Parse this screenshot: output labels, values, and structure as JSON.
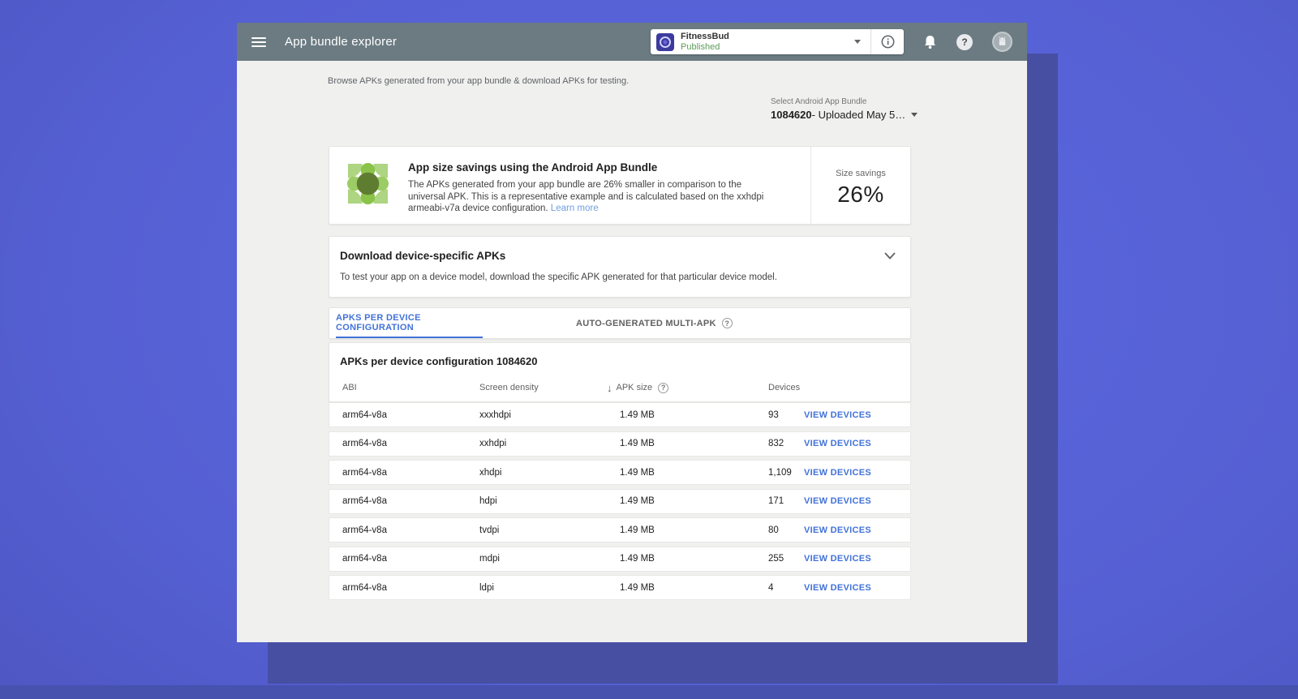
{
  "header": {
    "title": "App bundle explorer",
    "app_selector": {
      "name": "FitnessBud",
      "status": "Published"
    },
    "icons": [
      "menu",
      "app-logo",
      "dropdown-caret",
      "info",
      "notifications-bell",
      "help",
      "avatar-android"
    ]
  },
  "page": {
    "subtitle": "Browse APKs generated from your app bundle & download APKs for testing."
  },
  "bundle_select": {
    "label": "Select Android App Bundle",
    "value_bold": "1084620",
    "value_rest": " - Uploaded May 5…"
  },
  "savings_card": {
    "title": "App size savings using the Android App Bundle",
    "body": "The APKs generated from your app bundle are 26% smaller in comparison to the universal APK. This is a representative example and is calculated based on the xxhdpi armeabi-v7a device configuration. ",
    "learn_more": "Learn more",
    "savings_label": "Size savings",
    "savings_value": "26%"
  },
  "download_card": {
    "title": "Download device-specific APKs",
    "body": "To test your app on a device model, download the specific APK generated for that particular device model."
  },
  "tabs": [
    {
      "label": "APKS PER DEVICE CONFIGURATION",
      "active": true
    },
    {
      "label": "AUTO-GENERATED MULTI-APK",
      "active": false,
      "help_icon": true
    }
  ],
  "table": {
    "heading": "APKs per device configuration 1084620",
    "columns": {
      "abi": "ABI",
      "density": "Screen density",
      "size": "APK size",
      "devices": "Devices"
    },
    "sort_arrow": "↓",
    "action_label": "VIEW DEVICES",
    "rows": [
      {
        "abi": "arm64-v8a",
        "density": "xxxhdpi",
        "size": "1.49 MB",
        "devices": "93"
      },
      {
        "abi": "arm64-v8a",
        "density": "xxhdpi",
        "size": "1.49 MB",
        "devices": "832"
      },
      {
        "abi": "arm64-v8a",
        "density": "xhdpi",
        "size": "1.49 MB",
        "devices": "1,109"
      },
      {
        "abi": "arm64-v8a",
        "density": "hdpi",
        "size": "1.49 MB",
        "devices": "171"
      },
      {
        "abi": "arm64-v8a",
        "density": "tvdpi",
        "size": "1.49 MB",
        "devices": "80"
      },
      {
        "abi": "arm64-v8a",
        "density": "mdpi",
        "size": "1.49 MB",
        "devices": "255"
      },
      {
        "abi": "arm64-v8a",
        "density": "ldpi",
        "size": "1.49 MB",
        "devices": "4"
      }
    ]
  },
  "colors": {
    "background_blue": "#5560d3",
    "shadow_blue": "#474fa3",
    "header_gray": "#6b7b81",
    "accent_blue": "#4272d9",
    "link_light_blue": "#6f9fe0",
    "published_green": "#5d9c58",
    "bundle_icon_greens": [
      "#aed581",
      "#8bc34a",
      "#9ccc65",
      "#5f7d31"
    ]
  }
}
